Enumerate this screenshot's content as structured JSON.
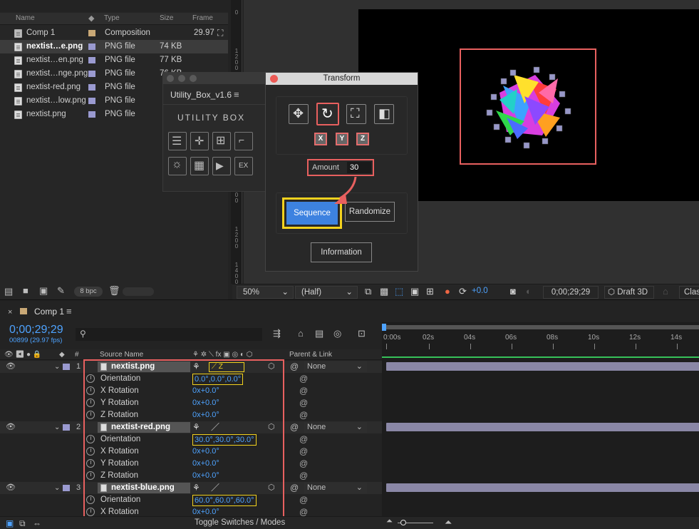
{
  "project": {
    "columns": {
      "name": "Name",
      "type": "Type",
      "size": "Size",
      "frame": "Frame"
    },
    "items": [
      {
        "name": "Comp 1",
        "type": "Composition",
        "size": "",
        "frame": "29.97",
        "selected": false
      },
      {
        "name": "nextist…e.png",
        "type": "PNG file",
        "size": "74 KB",
        "frame": "",
        "selected": true
      },
      {
        "name": "nextist…en.png",
        "type": "PNG file",
        "size": "77 KB",
        "frame": "",
        "selected": false
      },
      {
        "name": "nextist…nge.png",
        "type": "PNG file",
        "size": "76 KB",
        "frame": "",
        "selected": false
      },
      {
        "name": "nextist-red.png",
        "type": "PNG file",
        "size": "",
        "frame": "",
        "selected": false
      },
      {
        "name": "nextist…low.png",
        "type": "PNG file",
        "size": "",
        "frame": "",
        "selected": false
      },
      {
        "name": "nextist.png",
        "type": "PNG file",
        "size": "",
        "frame": "",
        "selected": false
      }
    ],
    "bpc": "8 bpc"
  },
  "utility_box": {
    "title": "Utility_Box_v1.6",
    "logo": "UTILITY BOX",
    "ex_label": "EX"
  },
  "transform": {
    "title": "Transform",
    "axes": [
      "X",
      "Y",
      "Z"
    ],
    "amount_label": "Amount",
    "amount_value": "30",
    "sequence": "Sequence",
    "randomize": "Randomize",
    "information": "Information"
  },
  "viewer_bar": {
    "zoom": "50%",
    "resolution": "(Half)",
    "exposure": "+0.0",
    "timecode": "0;00;29;29",
    "renderer": "Draft 3D",
    "extra": "Clas"
  },
  "timeline": {
    "tab": "Comp 1",
    "timecode": "0;00;29;29",
    "frames": "00899 (29.97 fps)",
    "search_placeholder": "",
    "col_num": "#",
    "col_source": "Source Name",
    "col_parent": "Parent & Link",
    "ruler": [
      "0:00s",
      "02s",
      "04s",
      "06s",
      "08s",
      "10s",
      "12s",
      "14s"
    ],
    "toggle": "Toggle Switches / Modes",
    "layers": [
      {
        "num": "1",
        "name": "nextist.png",
        "parent": "None",
        "props": [
          {
            "name": "Orientation",
            "value": "0.0°,0.0°,0.0°"
          },
          {
            "name": "X Rotation",
            "value": "0x+0.0°"
          },
          {
            "name": "Y Rotation",
            "value": "0x+0.0°"
          },
          {
            "name": "Z Rotation",
            "value": "0x+0.0°"
          }
        ]
      },
      {
        "num": "2",
        "name": "nextist-red.png",
        "parent": "None",
        "props": [
          {
            "name": "Orientation",
            "value": "30.0°,30.0°,30.0°"
          },
          {
            "name": "X Rotation",
            "value": "0x+0.0°"
          },
          {
            "name": "Y Rotation",
            "value": "0x+0.0°"
          },
          {
            "name": "Z Rotation",
            "value": "0x+0.0°"
          }
        ]
      },
      {
        "num": "3",
        "name": "nextist-blue.png",
        "parent": "None",
        "props": [
          {
            "name": "Orientation",
            "value": "60.0°,60.0°,60.0°"
          },
          {
            "name": "X Rotation",
            "value": "0x+0.0°"
          }
        ]
      }
    ]
  },
  "colors": {
    "accent_blue": "#4ea3ff",
    "highlight_red": "#e8605f",
    "highlight_yellow": "#f3d21e",
    "sequence_button": "#3d82e0"
  }
}
